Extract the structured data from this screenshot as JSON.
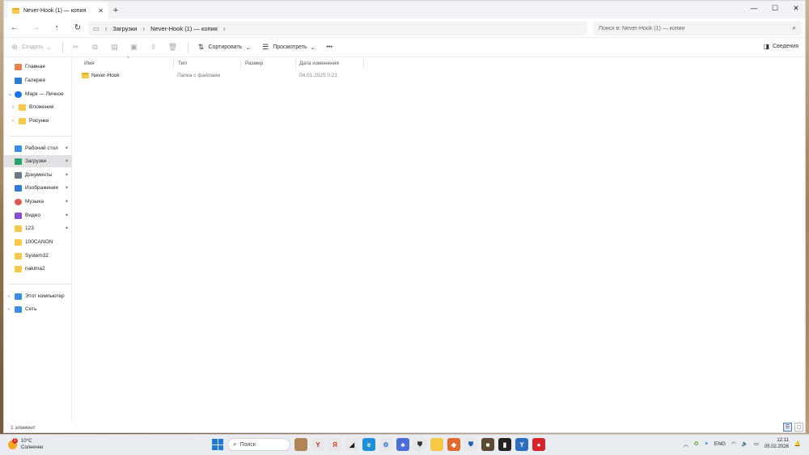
{
  "window": {
    "tab_title": "Never-Hook (1) — копия",
    "close_tab": "✕",
    "new_tab": "+",
    "controls": [
      "—",
      "☐",
      "✕"
    ]
  },
  "nav": {
    "back": "←",
    "forward": "→",
    "up": "↑",
    "refresh": "↻",
    "breadcrumb": [
      "Загрузки",
      "Never-Hook (1) — копия"
    ],
    "search_placeholder": "Поиск в: Never-Hook (1) — копия"
  },
  "commands": {
    "create": "Создать",
    "sort": "Сортировать",
    "view": "Просмотреть",
    "more": "•••",
    "details": "Сведения"
  },
  "sidebar": {
    "items": [
      {
        "label": "Главная",
        "icon": "home-icon",
        "color": "#e9824a"
      },
      {
        "label": "Галерея",
        "icon": "gallery-icon",
        "color": "#2f7bd6"
      },
      {
        "label": "Марк — Личное",
        "icon": "cloud-icon",
        "color": "#1a73e8"
      },
      {
        "label": "Вложения",
        "icon": "folder-icon",
        "color": "#f7c948"
      },
      {
        "label": "Рисунки",
        "icon": "folder-icon",
        "color": "#f7c948"
      },
      {
        "label": "Рабочий стол",
        "icon": "desktop-icon",
        "color": "#3a8de0"
      },
      {
        "label": "Загрузки",
        "icon": "download-icon",
        "color": "#2aa36b"
      },
      {
        "label": "Документы",
        "icon": "documents-icon",
        "color": "#6b7b8c"
      },
      {
        "label": "Изображения",
        "icon": "pictures-icon",
        "color": "#2f7bd6"
      },
      {
        "label": "Музыка",
        "icon": "music-icon",
        "color": "#e2574c"
      },
      {
        "label": "Видео",
        "icon": "video-icon",
        "color": "#8a4fd0"
      },
      {
        "label": "123",
        "icon": "folder-icon",
        "color": "#f7c948"
      },
      {
        "label": "100CANON",
        "icon": "folder-icon",
        "color": "#f7c948"
      },
      {
        "label": "System32",
        "icon": "folder-icon",
        "color": "#f7c948"
      },
      {
        "label": "nakima2",
        "icon": "folder-icon",
        "color": "#f7c948"
      },
      {
        "label": "Этот компьютер",
        "icon": "computer-icon",
        "color": "#3a8de0"
      },
      {
        "label": "Сеть",
        "icon": "network-icon",
        "color": "#3a8de0"
      }
    ]
  },
  "columns": {
    "name": "Имя",
    "type": "Тип",
    "size": "Размер",
    "modified": "Дата изменения"
  },
  "files": [
    {
      "name": "Never-Hook",
      "type": "Папка с файлами",
      "size": "",
      "modified": "04.01.2025 0:21"
    }
  ],
  "status": {
    "count": "1 элемент"
  },
  "taskbar": {
    "temp": "10°C",
    "weather": "Солнечно",
    "badge": "1",
    "search": "Поиск",
    "lang": "ENG",
    "time": "12:11",
    "date": "05.02.2026"
  }
}
